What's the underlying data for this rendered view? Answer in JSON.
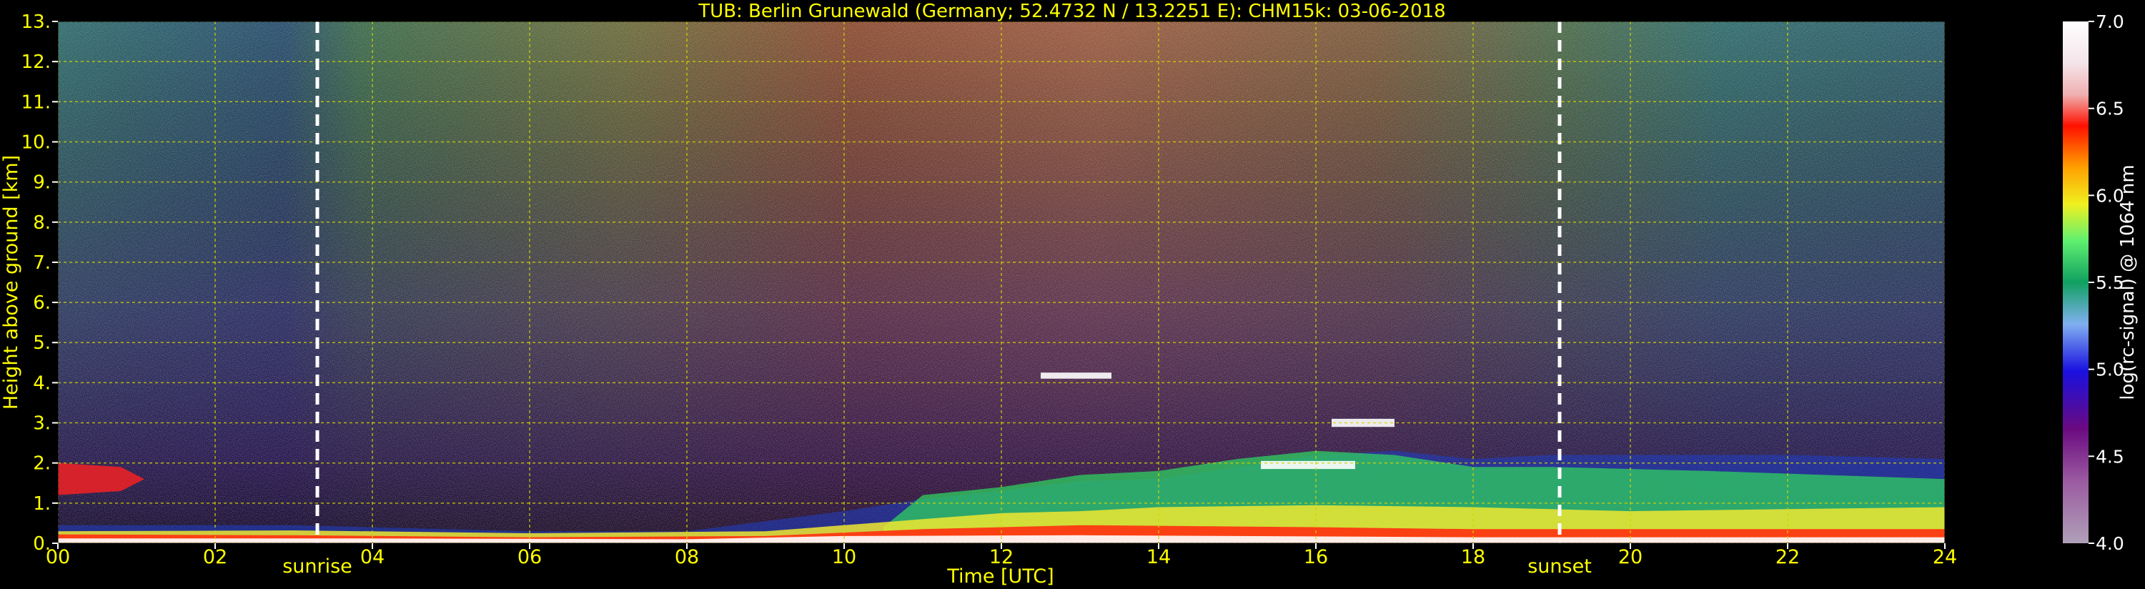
{
  "chart_data": {
    "type": "heatmap",
    "title": "TUB: Berlin Grunewald (Germany; 52.4732 N / 13.2251 E):    CHM15k: 03-06-2018",
    "xlabel": "Time [UTC]",
    "ylabel": "Height above ground [km]",
    "colorbar_label": "log(rc-signal) @ 1064 nm",
    "xlim": [
      0,
      24
    ],
    "ylim": [
      0,
      13
    ],
    "x_ticks": [
      "00",
      "02",
      "04",
      "06",
      "08",
      "10",
      "12",
      "14",
      "16",
      "18",
      "20",
      "22",
      "24"
    ],
    "y_ticks": [
      "0.",
      "1.",
      "2.",
      "3.",
      "4.",
      "5.",
      "6.",
      "7.",
      "8.",
      "9.",
      "10.",
      "11.",
      "12.",
      "13."
    ],
    "colorbar_range": [
      4.0,
      7.0
    ],
    "colorbar_ticks": [
      "4.0",
      "4.5",
      "5.0",
      "5.5",
      "6.0",
      "6.5",
      "7.0"
    ],
    "grid": true,
    "events": [
      {
        "label": "sunrise",
        "time_utc": 3.3
      },
      {
        "label": "sunset",
        "time_utc": 19.1
      }
    ],
    "colors": {
      "text": "#ffff00",
      "background": "#000000",
      "grid": "#d4d400",
      "event_line": "#ffffff"
    }
  }
}
